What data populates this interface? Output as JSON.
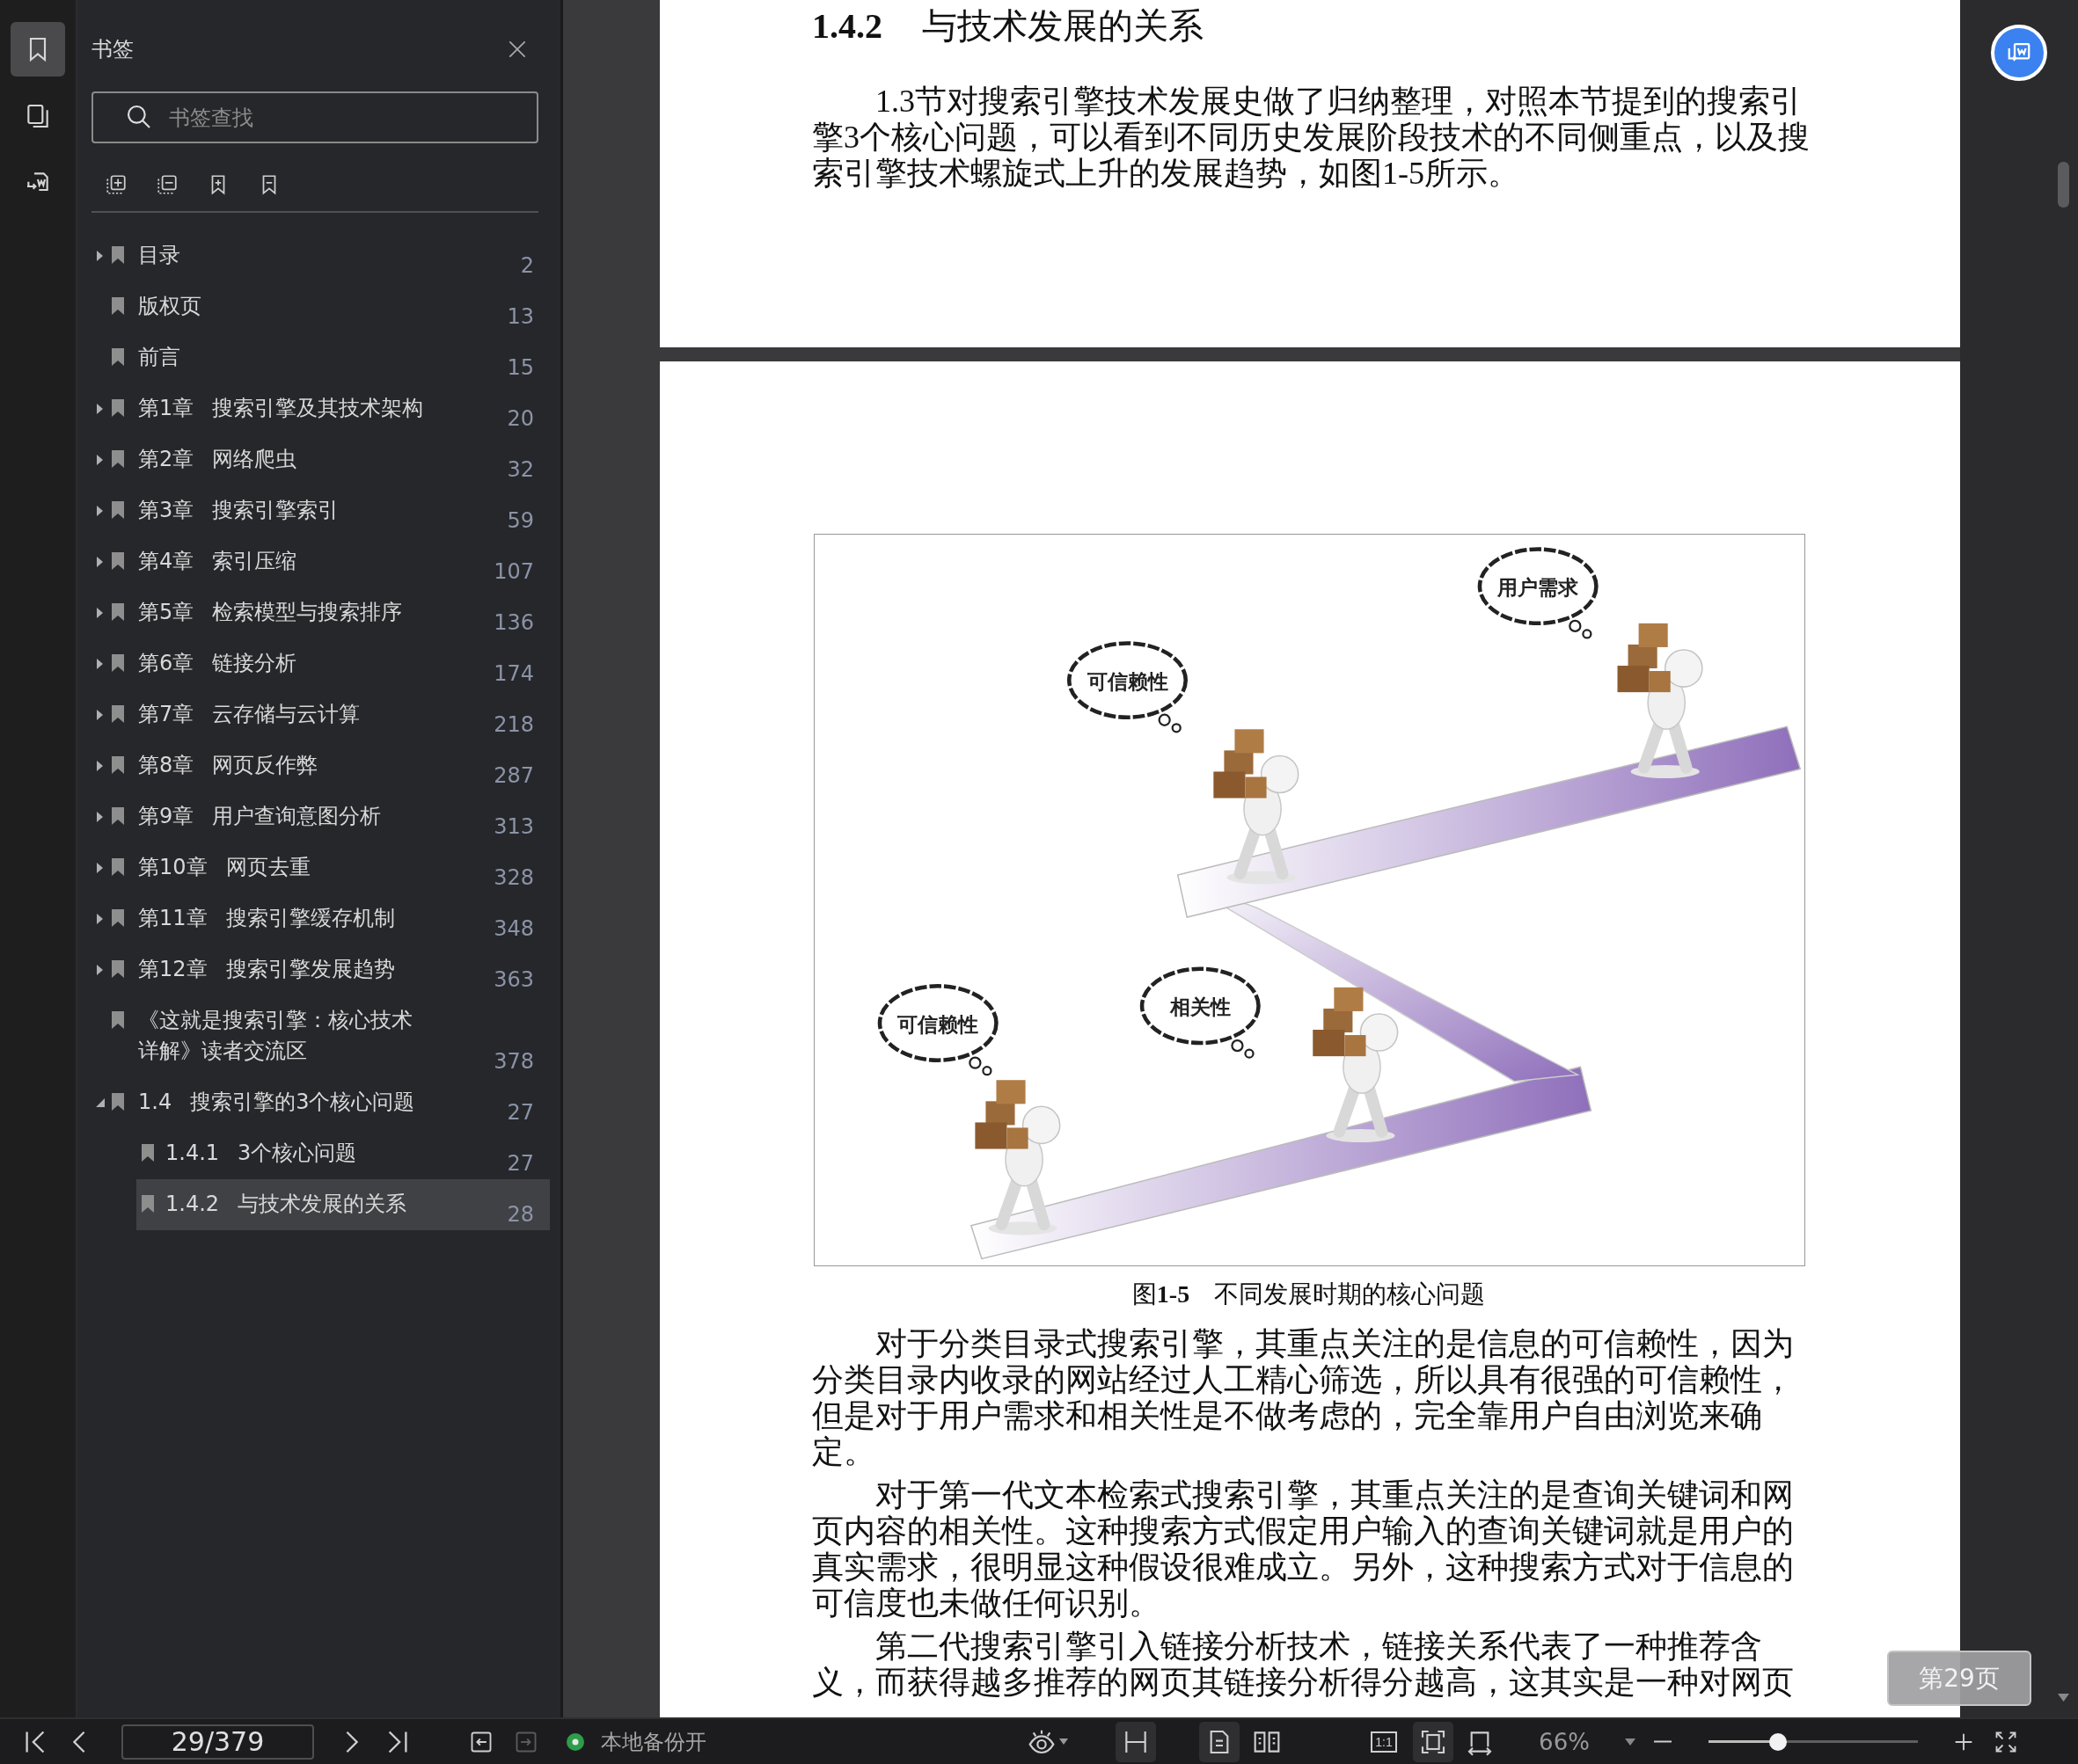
{
  "rail_tabs": [
    {
      "kind": "bookmarks",
      "selected": true
    },
    {
      "kind": "thumbnails",
      "selected": false
    },
    {
      "kind": "convert",
      "selected": false
    }
  ],
  "sidebar": {
    "title": "书签",
    "search": {
      "placeholder": "书签查找"
    },
    "bookmarks": [
      {
        "expanded": false,
        "selected": false,
        "title": "目录",
        "page": "2"
      },
      {
        "selected": false,
        "title": "版权页",
        "page": "13"
      },
      {
        "selected": false,
        "title": "前言",
        "page": "15"
      },
      {
        "expanded": false,
        "selected": false,
        "number": "第1章",
        "title": "搜索引擎及其技术架构",
        "page": "20"
      },
      {
        "expanded": false,
        "selected": false,
        "number": "第2章",
        "title": "网络爬虫",
        "page": "32"
      },
      {
        "expanded": false,
        "selected": false,
        "number": "第3章",
        "title": "搜索引擎索引",
        "page": "59"
      },
      {
        "expanded": false,
        "selected": false,
        "number": "第4章",
        "title": "索引压缩",
        "page": "107"
      },
      {
        "expanded": false,
        "selected": false,
        "number": "第5章",
        "title": "检索模型与搜索排序",
        "page": "136"
      },
      {
        "expanded": false,
        "selected": false,
        "number": "第6章",
        "title": "链接分析",
        "page": "174"
      },
      {
        "expanded": false,
        "selected": false,
        "number": "第7章",
        "title": "云存储与云计算",
        "page": "218"
      },
      {
        "expanded": false,
        "selected": false,
        "number": "第8章",
        "title": "网页反作弊",
        "page": "287"
      },
      {
        "expanded": false,
        "selected": false,
        "number": "第9章",
        "title": "用户查询意图分析",
        "page": "313"
      },
      {
        "expanded": false,
        "selected": false,
        "number": "第10章",
        "title": "网页去重",
        "page": "328"
      },
      {
        "expanded": false,
        "selected": false,
        "number": "第11章",
        "title": "搜索引擎缓存机制",
        "page": "348"
      },
      {
        "expanded": false,
        "selected": false,
        "number": "第12章",
        "title": "搜索引擎发展趋势",
        "page": "363"
      },
      {
        "selected": false,
        "title": "《这就是搜索引擎：核心技术详解》读者交流区",
        "page": "378"
      },
      {
        "expanded": true,
        "selected": false,
        "number": "1.4",
        "title": "搜索引擎的3个核心问题",
        "page": "27",
        "children": [
          {
            "selected": false,
            "number": "1.4.1",
            "title": "3个核心问题",
            "page": "27"
          },
          {
            "selected": true,
            "number": "1.4.2",
            "title": "与技术发展的关系",
            "page": "28"
          }
        ]
      }
    ]
  },
  "document": {
    "pages": [
      {
        "heading": {
          "number": "1.4.2",
          "title": "与技术发展的关系"
        },
        "paragraphs": [
          "1.3节对搜索引擎技术发展史做了归纳整理，对照本节提到的搜索引擎3个核心问题，可以看到不同历史发展阶段技术的不同侧重点，以及搜索引擎技术螺旋式上升的发展趋势，如图1-5所示。"
        ]
      },
      {
        "figure": {
          "bubbles": [
            "用户需求",
            "可信赖性",
            "相关性",
            "可信赖性"
          ],
          "caption": "图**1-5**　不同发展时期的核心问题"
        },
        "paragraphs": [
          "对于分类目录式搜索引擎，其重点关注的是信息的可信赖性，因为分类目录内收录的网站经过人工精心筛选，所以具有很强的可信赖性，但是对于用户需求和相关性是不做考虑的，完全靠用户自由浏览来确定。",
          "对于第一代文本检索式搜索引擎，其重点关注的是查询关键词和网页内容的相关性。这种搜索方式假定用户输入的查询关键词就是用户的真实需求，很明显这种假设很难成立。另外，这种搜索方式对于信息的可信度也未做任何识别。",
          "第二代搜索引擎引入链接分析技术，链接关系代表了一种推荐含义，而获得越多推荐的网页其链接分析得分越高，这其实是一种对网页"
        ]
      }
    ],
    "page_badge": "第29页"
  },
  "toolbar": {
    "page_field": "29/379",
    "export_buttons": [
      {
        "disabled": false
      },
      {
        "disabled": true
      }
    ],
    "backup": {
      "on": true,
      "label": "本地备份开"
    },
    "view_buttons": [
      {
        "kind": "scroll",
        "selected": true
      },
      {
        "kind": "single",
        "selected": true
      },
      {
        "kind": "double",
        "selected": false
      },
      {
        "kind": "actual",
        "selected": false,
        "label": "1:1"
      },
      {
        "kind": "fit-page",
        "selected": true
      },
      {
        "kind": "fit-width",
        "selected": false
      }
    ],
    "zoom": {
      "value": "66%",
      "level": 0.33
    }
  }
}
